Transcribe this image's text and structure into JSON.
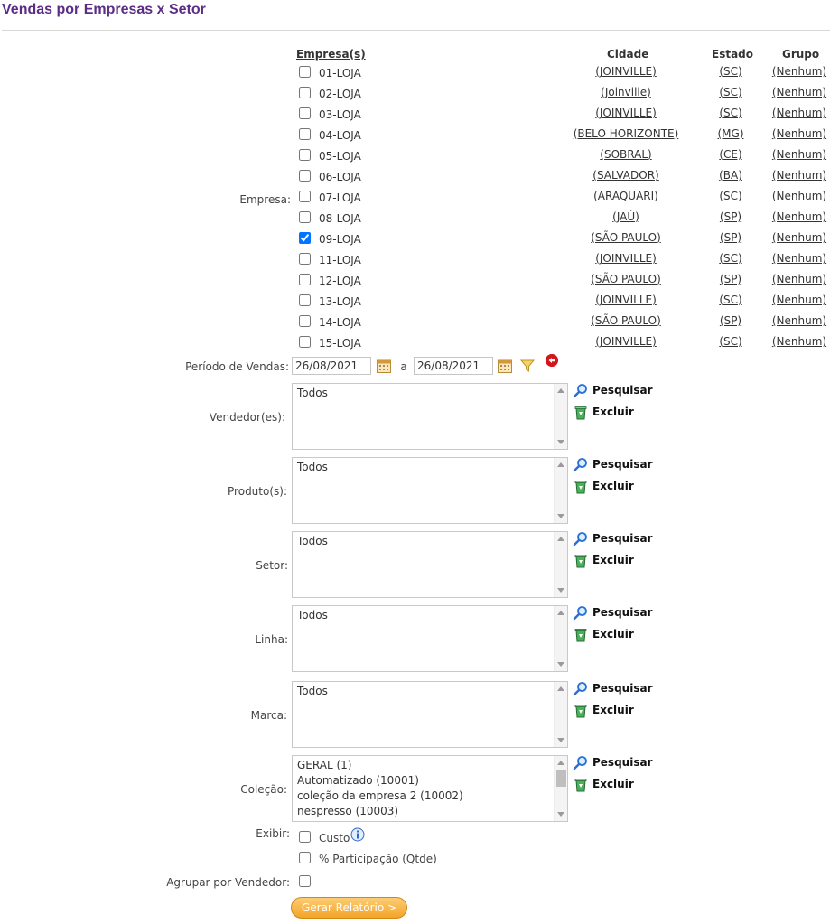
{
  "page": {
    "title": "Vendas por Empresas x Setor"
  },
  "empresa": {
    "label": "Empresa:",
    "headers": {
      "empresa": "Empresa(s)",
      "cidade": "Cidade",
      "estado": "Estado",
      "grupo": "Grupo"
    },
    "rows": [
      {
        "name": "01-LOJA",
        "city": "(JOINVILLE)",
        "state": "(SC)",
        "group": "(Nenhum)",
        "checked": false
      },
      {
        "name": "02-LOJA",
        "city": "(Joinville)",
        "state": "(SC)",
        "group": "(Nenhum)",
        "checked": false
      },
      {
        "name": "03-LOJA",
        "city": "(JOINVILLE)",
        "state": "(SC)",
        "group": "(Nenhum)",
        "checked": false
      },
      {
        "name": "04-LOJA",
        "city": "(BELO HORIZONTE)",
        "state": "(MG)",
        "group": "(Nenhum)",
        "checked": false
      },
      {
        "name": "05-LOJA",
        "city": "(SOBRAL)",
        "state": "(CE)",
        "group": "(Nenhum)",
        "checked": false
      },
      {
        "name": "06-LOJA",
        "city": "(SALVADOR)",
        "state": "(BA)",
        "group": "(Nenhum)",
        "checked": false
      },
      {
        "name": "07-LOJA",
        "city": "(ARAQUARI)",
        "state": "(SC)",
        "group": "(Nenhum)",
        "checked": false
      },
      {
        "name": "08-LOJA",
        "city": "(JAÚ)",
        "state": "(SP)",
        "group": "(Nenhum)",
        "checked": false
      },
      {
        "name": "09-LOJA",
        "city": "(SÃO PAULO)",
        "state": "(SP)",
        "group": "(Nenhum)",
        "checked": true
      },
      {
        "name": "11-LOJA",
        "city": "(JOINVILLE)",
        "state": "(SC)",
        "group": "(Nenhum)",
        "checked": false
      },
      {
        "name": "12-LOJA",
        "city": "(SÃO PAULO)",
        "state": "(SP)",
        "group": "(Nenhum)",
        "checked": false
      },
      {
        "name": "13-LOJA",
        "city": "(JOINVILLE)",
        "state": "(SC)",
        "group": "(Nenhum)",
        "checked": false
      },
      {
        "name": "14-LOJA",
        "city": "(SÃO PAULO)",
        "state": "(SP)",
        "group": "(Nenhum)",
        "checked": false
      },
      {
        "name": "15-LOJA",
        "city": "(JOINVILLE)",
        "state": "(SC)",
        "group": "(Nenhum)",
        "checked": false
      }
    ]
  },
  "periodo": {
    "label": "Período de Vendas:",
    "from": "26/08/2021",
    "sep": "a",
    "to": "26/08/2021"
  },
  "actions": {
    "search": "Pesquisar",
    "delete": "Excluir"
  },
  "vendedor": {
    "label": "Vendedor(es):",
    "options": [
      "Todos"
    ]
  },
  "produto": {
    "label": "Produto(s):",
    "options": [
      "Todos"
    ]
  },
  "setor": {
    "label": "Setor:",
    "options": [
      "Todos"
    ]
  },
  "linha": {
    "label": "Linha:",
    "options": [
      "Todos"
    ]
  },
  "marca": {
    "label": "Marca:",
    "options": [
      "Todos"
    ]
  },
  "colecao": {
    "label": "Coleção:",
    "options": [
      "GERAL (1)",
      "Automatizado (10001)",
      "coleção da empresa 2 (10002)",
      "nespresso (10003)"
    ]
  },
  "exibir": {
    "label": "Exibir:",
    "custo": "Custo",
    "participacao": "% Participação (Qtde)"
  },
  "agrupar": {
    "label": "Agrupar por Vendedor:"
  },
  "report_button": "Gerar Relatório >",
  "colors": {
    "title": "#5b2d86",
    "button": "#f4a428",
    "link": "#333333",
    "checkbox_accent": "#1a73e8"
  }
}
